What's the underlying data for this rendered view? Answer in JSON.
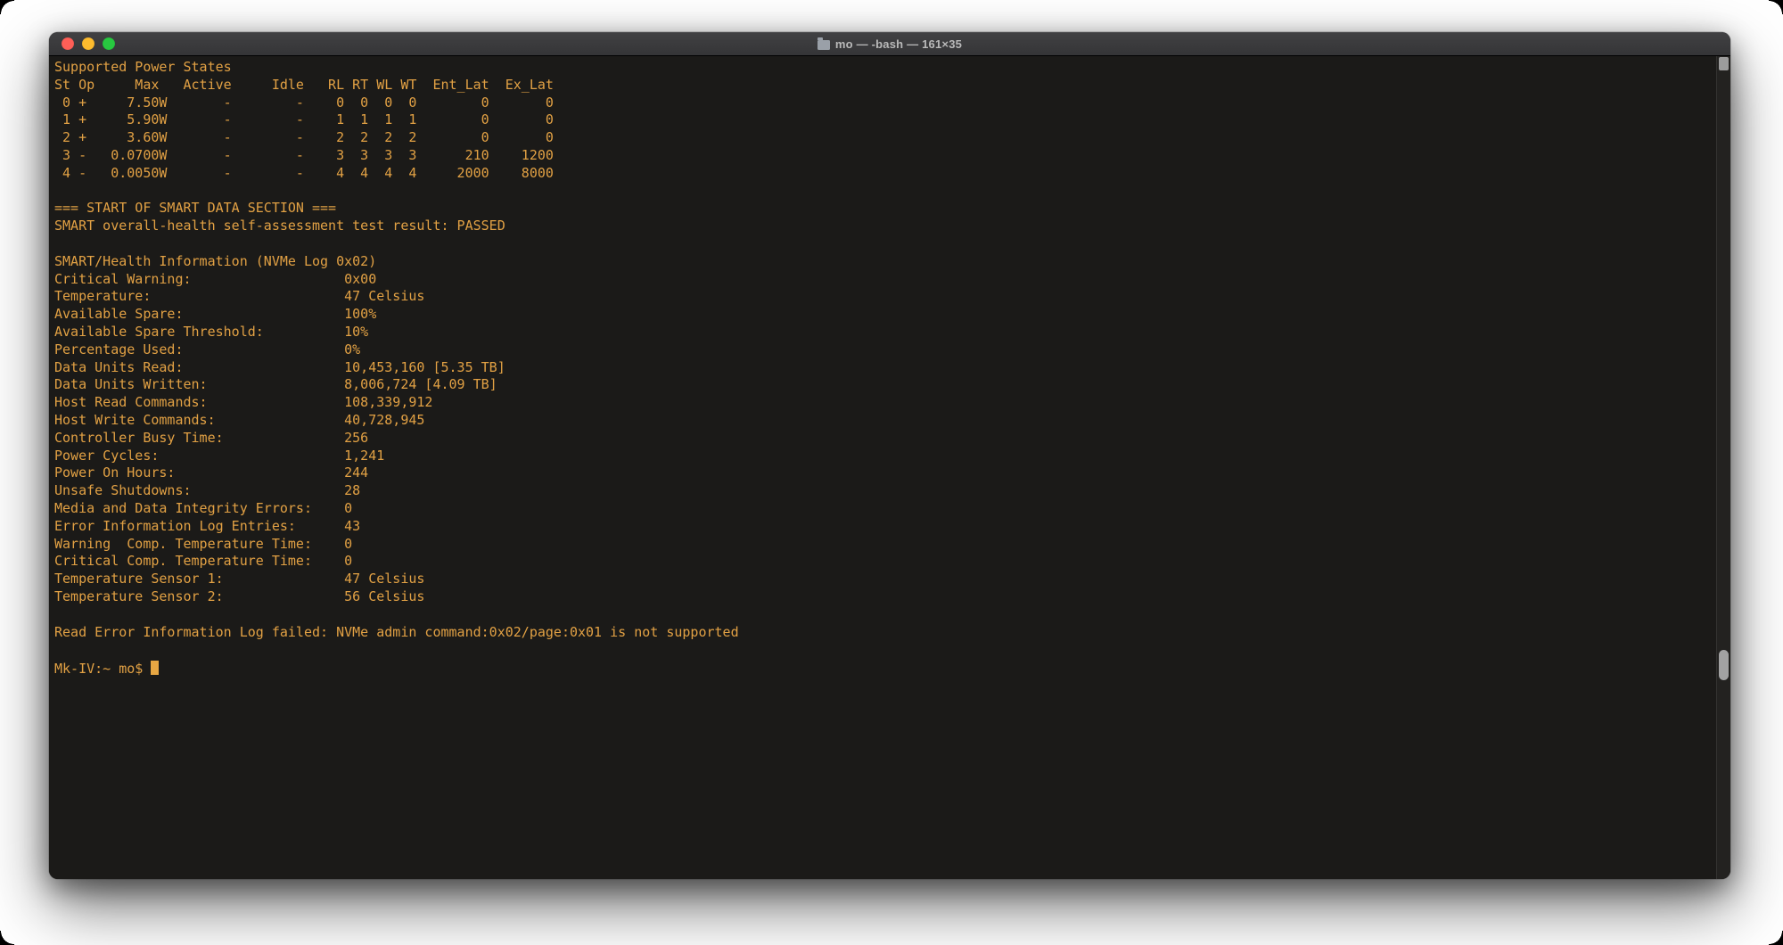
{
  "window": {
    "title": "mo — -bash — 161×35",
    "proxy_icon": "folder-icon",
    "traffic_lights": {
      "close": "#ff5f57",
      "minimize": "#febc2e",
      "zoom": "#28c840"
    },
    "colors": {
      "titlebar_bg": "#3a3a3c",
      "titlebar_text": "#b9b9b9",
      "terminal_bg": "#1b1a18",
      "terminal_text": "#e2a144",
      "cursor": "#e8a743",
      "scrollbar_thumb": "#a2a2a2"
    }
  },
  "terminal": {
    "shell": "-bash",
    "grid_size": "161×35",
    "prompt": "Mk-IV:~ mo$",
    "lines": [
      "Supported Power States",
      "St Op     Max   Active     Idle   RL RT WL WT  Ent_Lat  Ex_Lat",
      " 0 +     7.50W       -        -    0  0  0  0        0       0",
      " 1 +     5.90W       -        -    1  1  1  1        0       0",
      " 2 +     3.60W       -        -    2  2  2  2        0       0",
      " 3 -   0.0700W       -        -    3  3  3  3      210    1200",
      " 4 -   0.0050W       -        -    4  4  4  4     2000    8000",
      "",
      "=== START OF SMART DATA SECTION ===",
      "SMART overall-health self-assessment test result: PASSED",
      "",
      "SMART/Health Information (NVMe Log 0x02)",
      "Critical Warning:                   0x00",
      "Temperature:                        47 Celsius",
      "Available Spare:                    100%",
      "Available Spare Threshold:          10%",
      "Percentage Used:                    0%",
      "Data Units Read:                    10,453,160 [5.35 TB]",
      "Data Units Written:                 8,006,724 [4.09 TB]",
      "Host Read Commands:                 108,339,912",
      "Host Write Commands:                40,728,945",
      "Controller Busy Time:               256",
      "Power Cycles:                       1,241",
      "Power On Hours:                     244",
      "Unsafe Shutdowns:                   28",
      "Media and Data Integrity Errors:    0",
      "Error Information Log Entries:      43",
      "Warning  Comp. Temperature Time:    0",
      "Critical Comp. Temperature Time:    0",
      "Temperature Sensor 1:               47 Celsius",
      "Temperature Sensor 2:               56 Celsius",
      "",
      "Read Error Information Log failed: NVMe admin command:0x02/page:0x01 is not supported",
      "",
      "Mk-IV:~ mo$ "
    ]
  }
}
